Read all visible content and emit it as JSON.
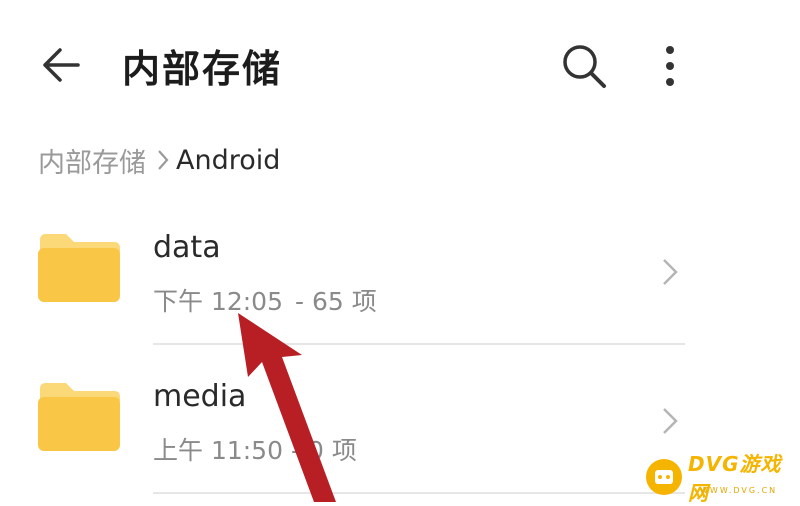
{
  "header": {
    "title": "内部存储",
    "back_icon": "arrow-left-icon",
    "search_icon": "search-icon",
    "more_icon": "more-vertical-icon"
  },
  "breadcrumb": {
    "root": "内部存储",
    "current": "Android",
    "separator_icon": "chevron-right-icon"
  },
  "files": [
    {
      "name": "data",
      "time": "下午 12:05",
      "count": "- 65 项",
      "icon": "folder-icon"
    },
    {
      "name": "media",
      "time": "上午 11:50",
      "count": "- 0 项",
      "icon": "folder-icon"
    }
  ],
  "annotation": {
    "arrow_color": "#b81f24"
  },
  "watermark": {
    "text": "DVG游戏网",
    "sub": "WWW.DVG.CN"
  },
  "colors": {
    "folder": "#f9c646",
    "folder_tab": "#fbd878",
    "text_primary": "#2a2a2a",
    "text_secondary": "#8a8a8a"
  }
}
